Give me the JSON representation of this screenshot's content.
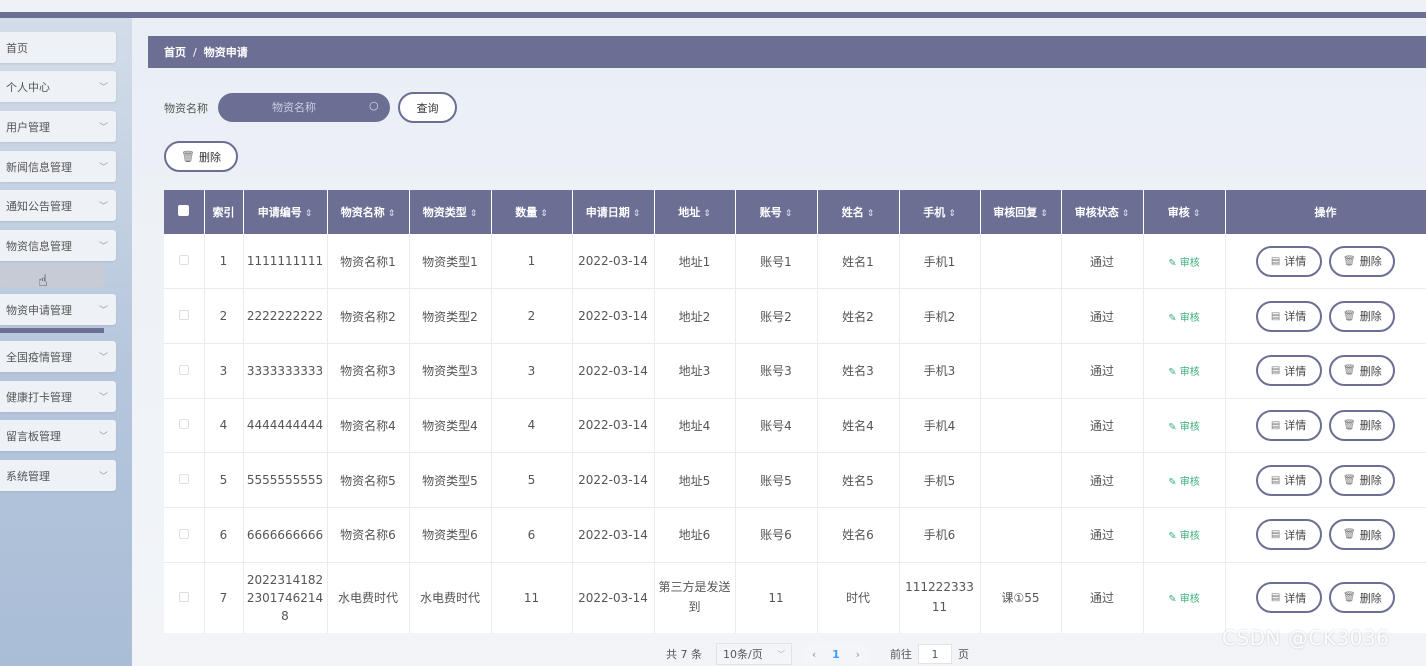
{
  "sidebar": {
    "items": [
      {
        "label": "首页",
        "chevron": false
      },
      {
        "label": "个人中心",
        "chevron": true
      },
      {
        "label": "用户管理",
        "chevron": true
      },
      {
        "label": "新闻信息管理",
        "chevron": true
      },
      {
        "label": "通知公告管理",
        "chevron": true
      },
      {
        "label": "物资信息管理",
        "chevron": true
      },
      {
        "label": "物资申请管理",
        "chevron": true
      },
      {
        "label": "全国疫情管理",
        "chevron": true
      },
      {
        "label": "健康打卡管理",
        "chevron": true
      },
      {
        "label": "留言板管理",
        "chevron": true
      },
      {
        "label": "系统管理",
        "chevron": true
      }
    ]
  },
  "breadcrumb": {
    "home": "首页",
    "separator": "/",
    "current": "物资申请"
  },
  "search": {
    "label": "物资名称",
    "placeholder": "物资名称",
    "button": "查询"
  },
  "toolbar": {
    "delete_label": "删除"
  },
  "table": {
    "columns": [
      "索引",
      "申请编号",
      "物资名称",
      "物资类型",
      "数量",
      "申请日期",
      "地址",
      "账号",
      "姓名",
      "手机",
      "审核回复",
      "审核状态",
      "审核",
      "操作"
    ],
    "rows": [
      {
        "index": "1",
        "code": "1111111111",
        "name": "物资名称1",
        "type": "物资类型1",
        "qty": "1",
        "date": "2022-03-14",
        "addr": "地址1",
        "account": "账号1",
        "person": "姓名1",
        "phone": "手机1",
        "reply": "",
        "status": "通过"
      },
      {
        "index": "2",
        "code": "2222222222",
        "name": "物资名称2",
        "type": "物资类型2",
        "qty": "2",
        "date": "2022-03-14",
        "addr": "地址2",
        "account": "账号2",
        "person": "姓名2",
        "phone": "手机2",
        "reply": "",
        "status": "通过"
      },
      {
        "index": "3",
        "code": "3333333333",
        "name": "物资名称3",
        "type": "物资类型3",
        "qty": "3",
        "date": "2022-03-14",
        "addr": "地址3",
        "account": "账号3",
        "person": "姓名3",
        "phone": "手机3",
        "reply": "",
        "status": "通过"
      },
      {
        "index": "4",
        "code": "4444444444",
        "name": "物资名称4",
        "type": "物资类型4",
        "qty": "4",
        "date": "2022-03-14",
        "addr": "地址4",
        "account": "账号4",
        "person": "姓名4",
        "phone": "手机4",
        "reply": "",
        "status": "通过"
      },
      {
        "index": "5",
        "code": "5555555555",
        "name": "物资名称5",
        "type": "物资类型5",
        "qty": "5",
        "date": "2022-03-14",
        "addr": "地址5",
        "account": "账号5",
        "person": "姓名5",
        "phone": "手机5",
        "reply": "",
        "status": "通过"
      },
      {
        "index": "6",
        "code": "6666666666",
        "name": "物资名称6",
        "type": "物资类型6",
        "qty": "6",
        "date": "2022-03-14",
        "addr": "地址6",
        "account": "账号6",
        "person": "姓名6",
        "phone": "手机6",
        "reply": "",
        "status": "通过"
      },
      {
        "index": "7",
        "code": "20223141822301746214 8",
        "name": "水电费时代",
        "type": "水电费时代",
        "qty": "11",
        "date": "2022-03-14",
        "addr": "第三方是发送到",
        "account": "11",
        "person": "时代",
        "phone": "11122233311",
        "reply": "课①55",
        "status": "通过"
      }
    ],
    "audit_label": "审核",
    "detail_label": "详情",
    "delete_label": "删除"
  },
  "pagination": {
    "total": "共 7 条",
    "page_size": "10条/页",
    "current_page": "1",
    "goto_prefix": "前往",
    "goto_value": "1",
    "goto_suffix": "页"
  },
  "watermark": "CSDN @CK3036",
  "colors": {
    "primary": "#6b6f94",
    "audit_green": "#3aaf7c",
    "page_blue": "#409eff"
  }
}
